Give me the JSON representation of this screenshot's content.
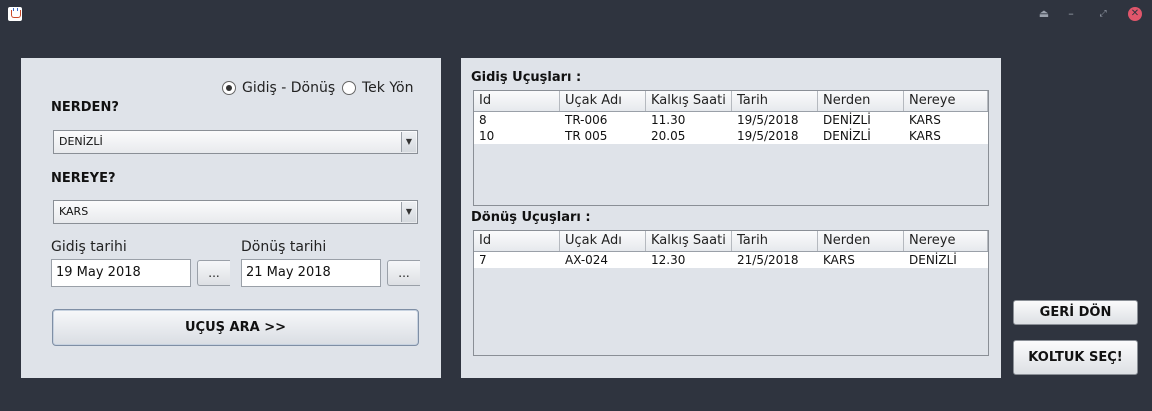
{
  "titlebar": {
    "controls": [
      "eject-icon",
      "minimize-icon",
      "restore-icon",
      "close-icon"
    ]
  },
  "search": {
    "trip_type": {
      "round_trip_label": "Gidiş - Dönüş",
      "one_way_label": "Tek Yön",
      "selected": "round_trip"
    },
    "from_label": "NERDEN?",
    "from_value": "DENİZLİ",
    "to_label": "NEREYE?",
    "to_value": "KARS",
    "depart_date_label": "Gidiş tarihi",
    "depart_date_value": "19 May 2018",
    "return_date_label": "Dönüş tarihi",
    "return_date_value": "21 May 2018",
    "picker_label": "...",
    "search_button": "UÇUŞ ARA >>"
  },
  "outbound": {
    "title": "Gidiş Uçuşları :",
    "columns": [
      "Id",
      "Uçak Adı",
      "Kalkış Saati",
      "Tarih",
      "Nerden",
      "Nereye"
    ],
    "rows": [
      [
        "8",
        "TR-006",
        "11.30",
        "19/5/2018",
        "DENİZLİ",
        "KARS"
      ],
      [
        "10",
        "TR 005",
        "20.05",
        "19/5/2018",
        "DENİZLİ",
        "KARS"
      ]
    ]
  },
  "return": {
    "title": "Dönüş Uçuşları :",
    "columns": [
      "Id",
      "Uçak Adı",
      "Kalkış Saati",
      "Tarih",
      "Nerden",
      "Nereye"
    ],
    "rows": [
      [
        "7",
        "AX-024",
        "12.30",
        "21/5/2018",
        "KARS",
        "DENİZLİ"
      ]
    ]
  },
  "actions": {
    "back_button": "GERİ DÖN",
    "select_seat_button": "KOLTUK SEÇ!"
  },
  "colors": {
    "window_bg": "#2f343f",
    "panel_bg": "#dfe3e9",
    "close_button": "#e0566b"
  }
}
